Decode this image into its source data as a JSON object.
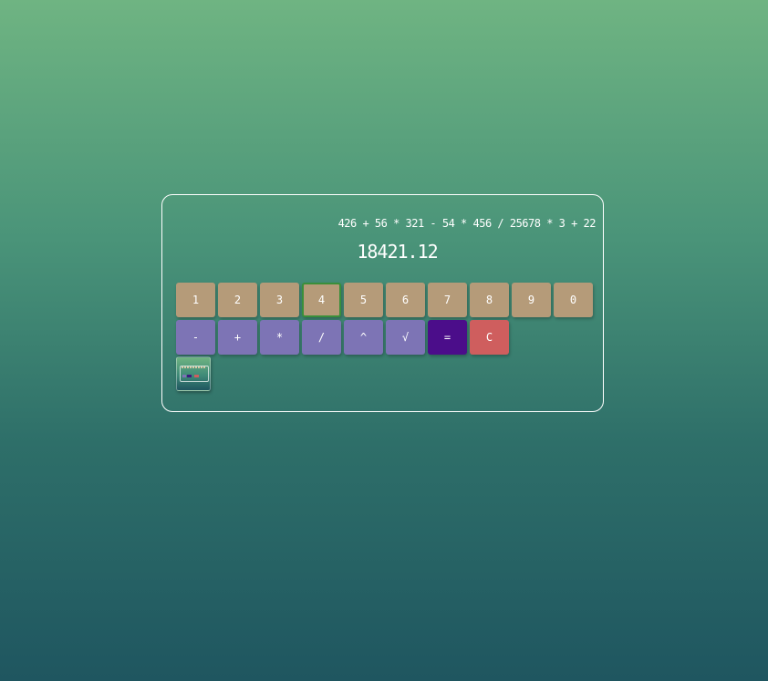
{
  "display": {
    "expression": "426 + 56 * 321 - 54 * 456 / 25678 * 3 + 22",
    "result": "18421.12"
  },
  "keypad": {
    "digits": [
      "1",
      "2",
      "3",
      "4",
      "5",
      "6",
      "7",
      "8",
      "9",
      "0"
    ],
    "operators": [
      "-",
      "+",
      "*",
      "/",
      "^",
      "√"
    ],
    "equals": "=",
    "clear": "C"
  },
  "colors": {
    "digit": "#b59b79",
    "operator": "#7d74b5",
    "equals": "#4b0d8a",
    "clear": "#cf5e5e",
    "active_border": "#3a8f3a"
  },
  "icons": {
    "thumbnail": "calculator-preview-thumbnail"
  }
}
